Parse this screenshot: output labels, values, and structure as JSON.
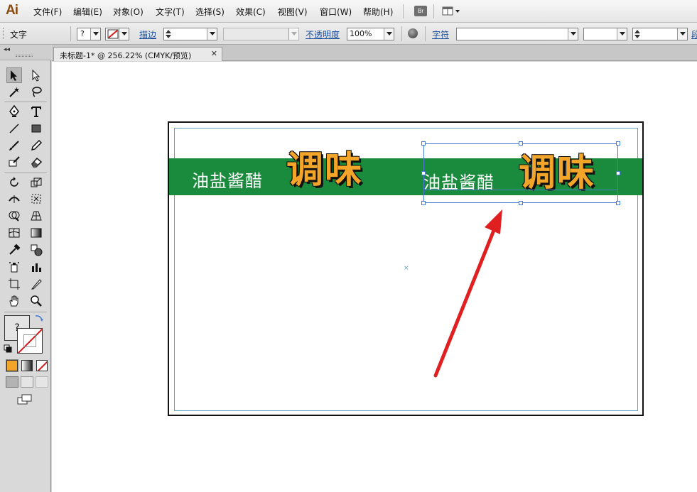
{
  "app": {
    "logo": "Ai"
  },
  "menu": {
    "items": [
      "文件(F)",
      "编辑(E)",
      "对象(O)",
      "文字(T)",
      "选择(S)",
      "效果(C)",
      "视图(V)",
      "窗口(W)",
      "帮助(H)"
    ],
    "bridge_label": "Br"
  },
  "control_bar": {
    "tool_label": "文字",
    "fill_value": "?",
    "stroke_label": "描边",
    "opacity_label": "不透明度",
    "opacity_value": "100%",
    "character_label": "字符",
    "truncated_label": "段"
  },
  "document": {
    "tab_title": "未标题-1* @ 256.22% (CMYK/预览)",
    "close_glyph": "✕"
  },
  "artwork": {
    "small_text_left": "油盐酱醋",
    "big_text_left": "调味",
    "small_text_right": "油盐酱醋",
    "big_text_right": "调味",
    "band_color": "#1a8a3c",
    "big_text_color": "#f3a52a",
    "center_mark": "×"
  },
  "tools_panel": {
    "collapse_glyph": "◂◂",
    "fill_placeholder": "?",
    "tools": [
      "selection-tool",
      "direct-selection-tool",
      "magic-wand-tool",
      "lasso-tool",
      "pen-tool",
      "type-tool",
      "line-segment-tool",
      "rectangle-tool",
      "paintbrush-tool",
      "pencil-tool",
      "blob-brush-tool",
      "eraser-tool",
      "rotate-tool",
      "scale-tool",
      "width-tool",
      "free-transform-tool",
      "shape-builder-tool",
      "perspective-grid-tool",
      "mesh-tool",
      "gradient-tool",
      "eyedropper-tool",
      "blend-tool",
      "symbol-sprayer-tool",
      "column-graph-tool",
      "artboard-tool",
      "slice-tool",
      "hand-tool",
      "zoom-tool"
    ]
  },
  "colors": {
    "annotation_arrow": "#e02020",
    "selection": "#4a7bd1"
  }
}
